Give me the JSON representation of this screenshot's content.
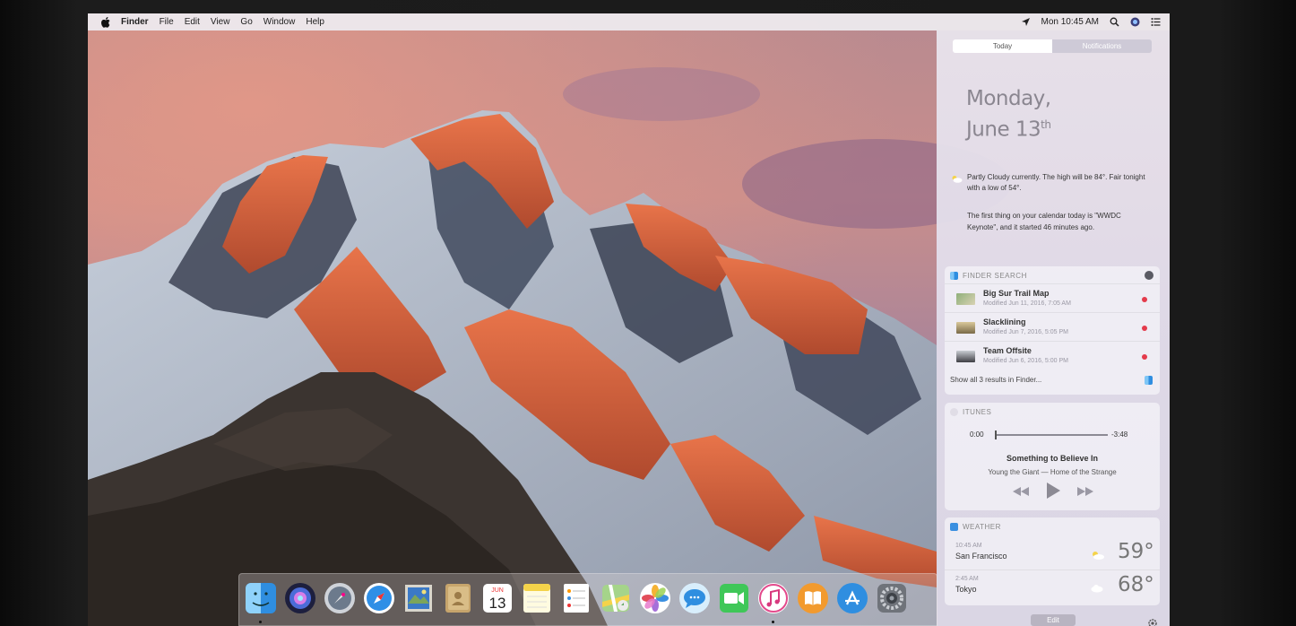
{
  "menubar": {
    "app_name": "Finder",
    "menus": [
      "File",
      "Edit",
      "View",
      "Go",
      "Window",
      "Help"
    ],
    "clock": "Mon 10:45 AM",
    "icons": [
      "apple-icon",
      "location-arrow-icon",
      "spotlight-icon",
      "siri-icon",
      "notification-center-icon"
    ]
  },
  "notification_center": {
    "tabs": {
      "today": "Today",
      "notifications": "Notifications"
    },
    "date_line1": "Monday,",
    "date_line2": "June 13",
    "date_suffix": "th",
    "weather_summary": "Partly Cloudy currently. The high will be 84°. Fair tonight with a low of 54°.",
    "calendar_summary": "The first thing on your calendar today is \"WWDC Keynote\", and it started 46 minutes ago.",
    "finder_search": {
      "title": "FINDER SEARCH",
      "results": [
        {
          "title": "Big Sur Trail Map",
          "meta": "Modified Jun 11, 2016, 7:05 AM"
        },
        {
          "title": "Slacklining",
          "meta": "Modified Jun 7, 2016, 5:05 PM"
        },
        {
          "title": "Team Offsite",
          "meta": "Modified Jun 6, 2016, 5:00 PM"
        }
      ],
      "show_all": "Show all 3 results in Finder..."
    },
    "itunes": {
      "title": "ITUNES",
      "time_start": "0:00",
      "time_end": "-3:48",
      "progress": 0.0,
      "song": "Something to Believe In",
      "artist": "Young the Giant — Home of the Strange"
    },
    "weather": {
      "title": "WEATHER",
      "cities": [
        {
          "time": "10:45 AM",
          "city": "San Francisco",
          "temp": "59°"
        },
        {
          "time": "2:45 AM",
          "city": "Tokyo",
          "temp": "68°"
        }
      ]
    },
    "edit_label": "Edit"
  },
  "dock": {
    "apps": [
      "finder-icon",
      "siri-icon",
      "launchpad-icon",
      "safari-icon",
      "mail-icon",
      "contacts-icon",
      "calendar-icon",
      "notes-icon",
      "reminders-icon",
      "maps-icon",
      "photos-icon",
      "messages-icon",
      "facetime-icon",
      "itunes-icon",
      "ibooks-icon",
      "app-store-icon",
      "system-preferences-icon"
    ],
    "calendar_month": "JUN",
    "calendar_day": "13"
  }
}
